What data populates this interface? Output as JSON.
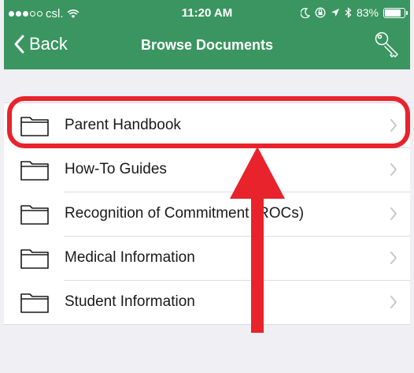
{
  "status_bar": {
    "carrier": "csl.",
    "time": "11:20 AM",
    "battery_percent": "83%",
    "battery_level": 0.83,
    "signal_bars_filled": 3,
    "signal_bars_total": 5
  },
  "nav": {
    "back_label": "Back",
    "title": "Browse Documents",
    "right_icon": "key-icon"
  },
  "list": {
    "items": [
      {
        "label": "Parent Handbook",
        "icon": "folder-icon"
      },
      {
        "label": "How-To Guides",
        "icon": "folder-icon"
      },
      {
        "label": "Recognition of Commitment (ROCs)",
        "icon": "folder-icon"
      },
      {
        "label": "Medical Information",
        "icon": "folder-icon"
      },
      {
        "label": "Student Information",
        "icon": "folder-icon"
      }
    ]
  },
  "annotation": {
    "highlight_color": "#e8232c",
    "highlighted_item": "Parent Handbook"
  },
  "colors": {
    "header": "#3a9560",
    "background": "#efeff4"
  }
}
